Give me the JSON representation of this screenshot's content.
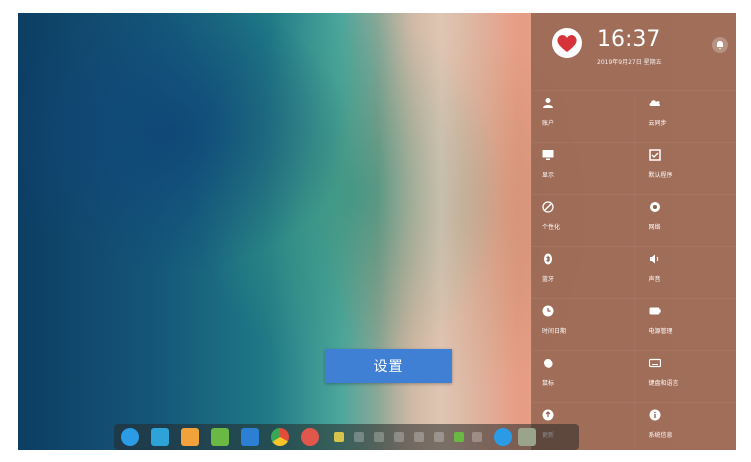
{
  "desktop": {
    "banner_text": "设置"
  },
  "control_center": {
    "time": "16:37",
    "date": "2019年9月27日 星期五",
    "items": [
      {
        "label": "账户",
        "icon": "user-icon"
      },
      {
        "label": "云同步",
        "icon": "cloud-icon"
      },
      {
        "label": "显示",
        "icon": "monitor-icon"
      },
      {
        "label": "默认程序",
        "icon": "default-apps-icon"
      },
      {
        "label": "个性化",
        "icon": "palette-icon"
      },
      {
        "label": "网络",
        "icon": "network-icon"
      },
      {
        "label": "蓝牙",
        "icon": "bluetooth-icon"
      },
      {
        "label": "声音",
        "icon": "speaker-icon"
      },
      {
        "label": "时间日期",
        "icon": "clock-icon"
      },
      {
        "label": "电源管理",
        "icon": "battery-icon"
      },
      {
        "label": "鼠标",
        "icon": "mouse-icon"
      },
      {
        "label": "键盘和语言",
        "icon": "keyboard-icon"
      },
      {
        "label": "更新",
        "icon": "update-icon"
      },
      {
        "label": "系统信息",
        "icon": "info-icon"
      }
    ]
  },
  "dock": {
    "apps": [
      {
        "name": "launcher-icon",
        "color": "#2c9be6"
      },
      {
        "name": "file-manager-icon",
        "color": "#2ea3d8"
      },
      {
        "name": "app-store-icon",
        "color": "#f2a23a"
      },
      {
        "name": "terminal-icon",
        "color": "#6ab945"
      },
      {
        "name": "media-player-icon",
        "color": "#2c7fd3"
      },
      {
        "name": "chrome-icon",
        "color": "#e34b3b"
      },
      {
        "name": "settings-icon",
        "color": "#e2574c"
      }
    ],
    "tray_icons": [
      "keyboard-layout-icon",
      "battery-tray-icon",
      "input-method-icon",
      "usb-icon",
      "volume-icon",
      "wifi-icon",
      "network-tray-icon",
      "arrow-icon",
      "power-icon",
      "trash-icon"
    ]
  }
}
